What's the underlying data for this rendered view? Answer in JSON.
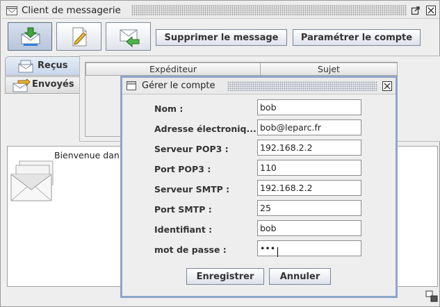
{
  "window": {
    "title": "Client de messagerie"
  },
  "toolbar": {
    "buttons": [
      {
        "icon": "receive-mail-icon"
      },
      {
        "icon": "compose-icon"
      },
      {
        "icon": "reply-icon"
      }
    ],
    "delete_label": "Supprimer le message",
    "settings_label": "Paramétrer le compte"
  },
  "tabs": [
    {
      "label": "Reçus",
      "icon": "inbox-icon",
      "selected": true
    },
    {
      "label": "Envoyés",
      "icon": "sent-icon",
      "selected": false
    }
  ],
  "table": {
    "columns": [
      "Expéditeur",
      "Sujet"
    ]
  },
  "preview": {
    "text": "Bienvenue dan"
  },
  "dialog": {
    "title": "Gérer le compte",
    "fields": [
      {
        "label": "Nom :",
        "value": "bob"
      },
      {
        "label": "Adresse électroniq...",
        "value": "bob@leparc.fr"
      },
      {
        "label": "Serveur POP3 :",
        "value": "192.168.2.2"
      },
      {
        "label": "Port POP3 :",
        "value": "110"
      },
      {
        "label": "Serveur SMTP :",
        "value": "192.168.2.2"
      },
      {
        "label": "Port SMTP :",
        "value": "25"
      },
      {
        "label": "Identifiant :",
        "value": "bob"
      },
      {
        "label": "mot de passe :",
        "value": "•••"
      }
    ],
    "save_label": "Enregistrer",
    "cancel_label": "Annuler"
  }
}
